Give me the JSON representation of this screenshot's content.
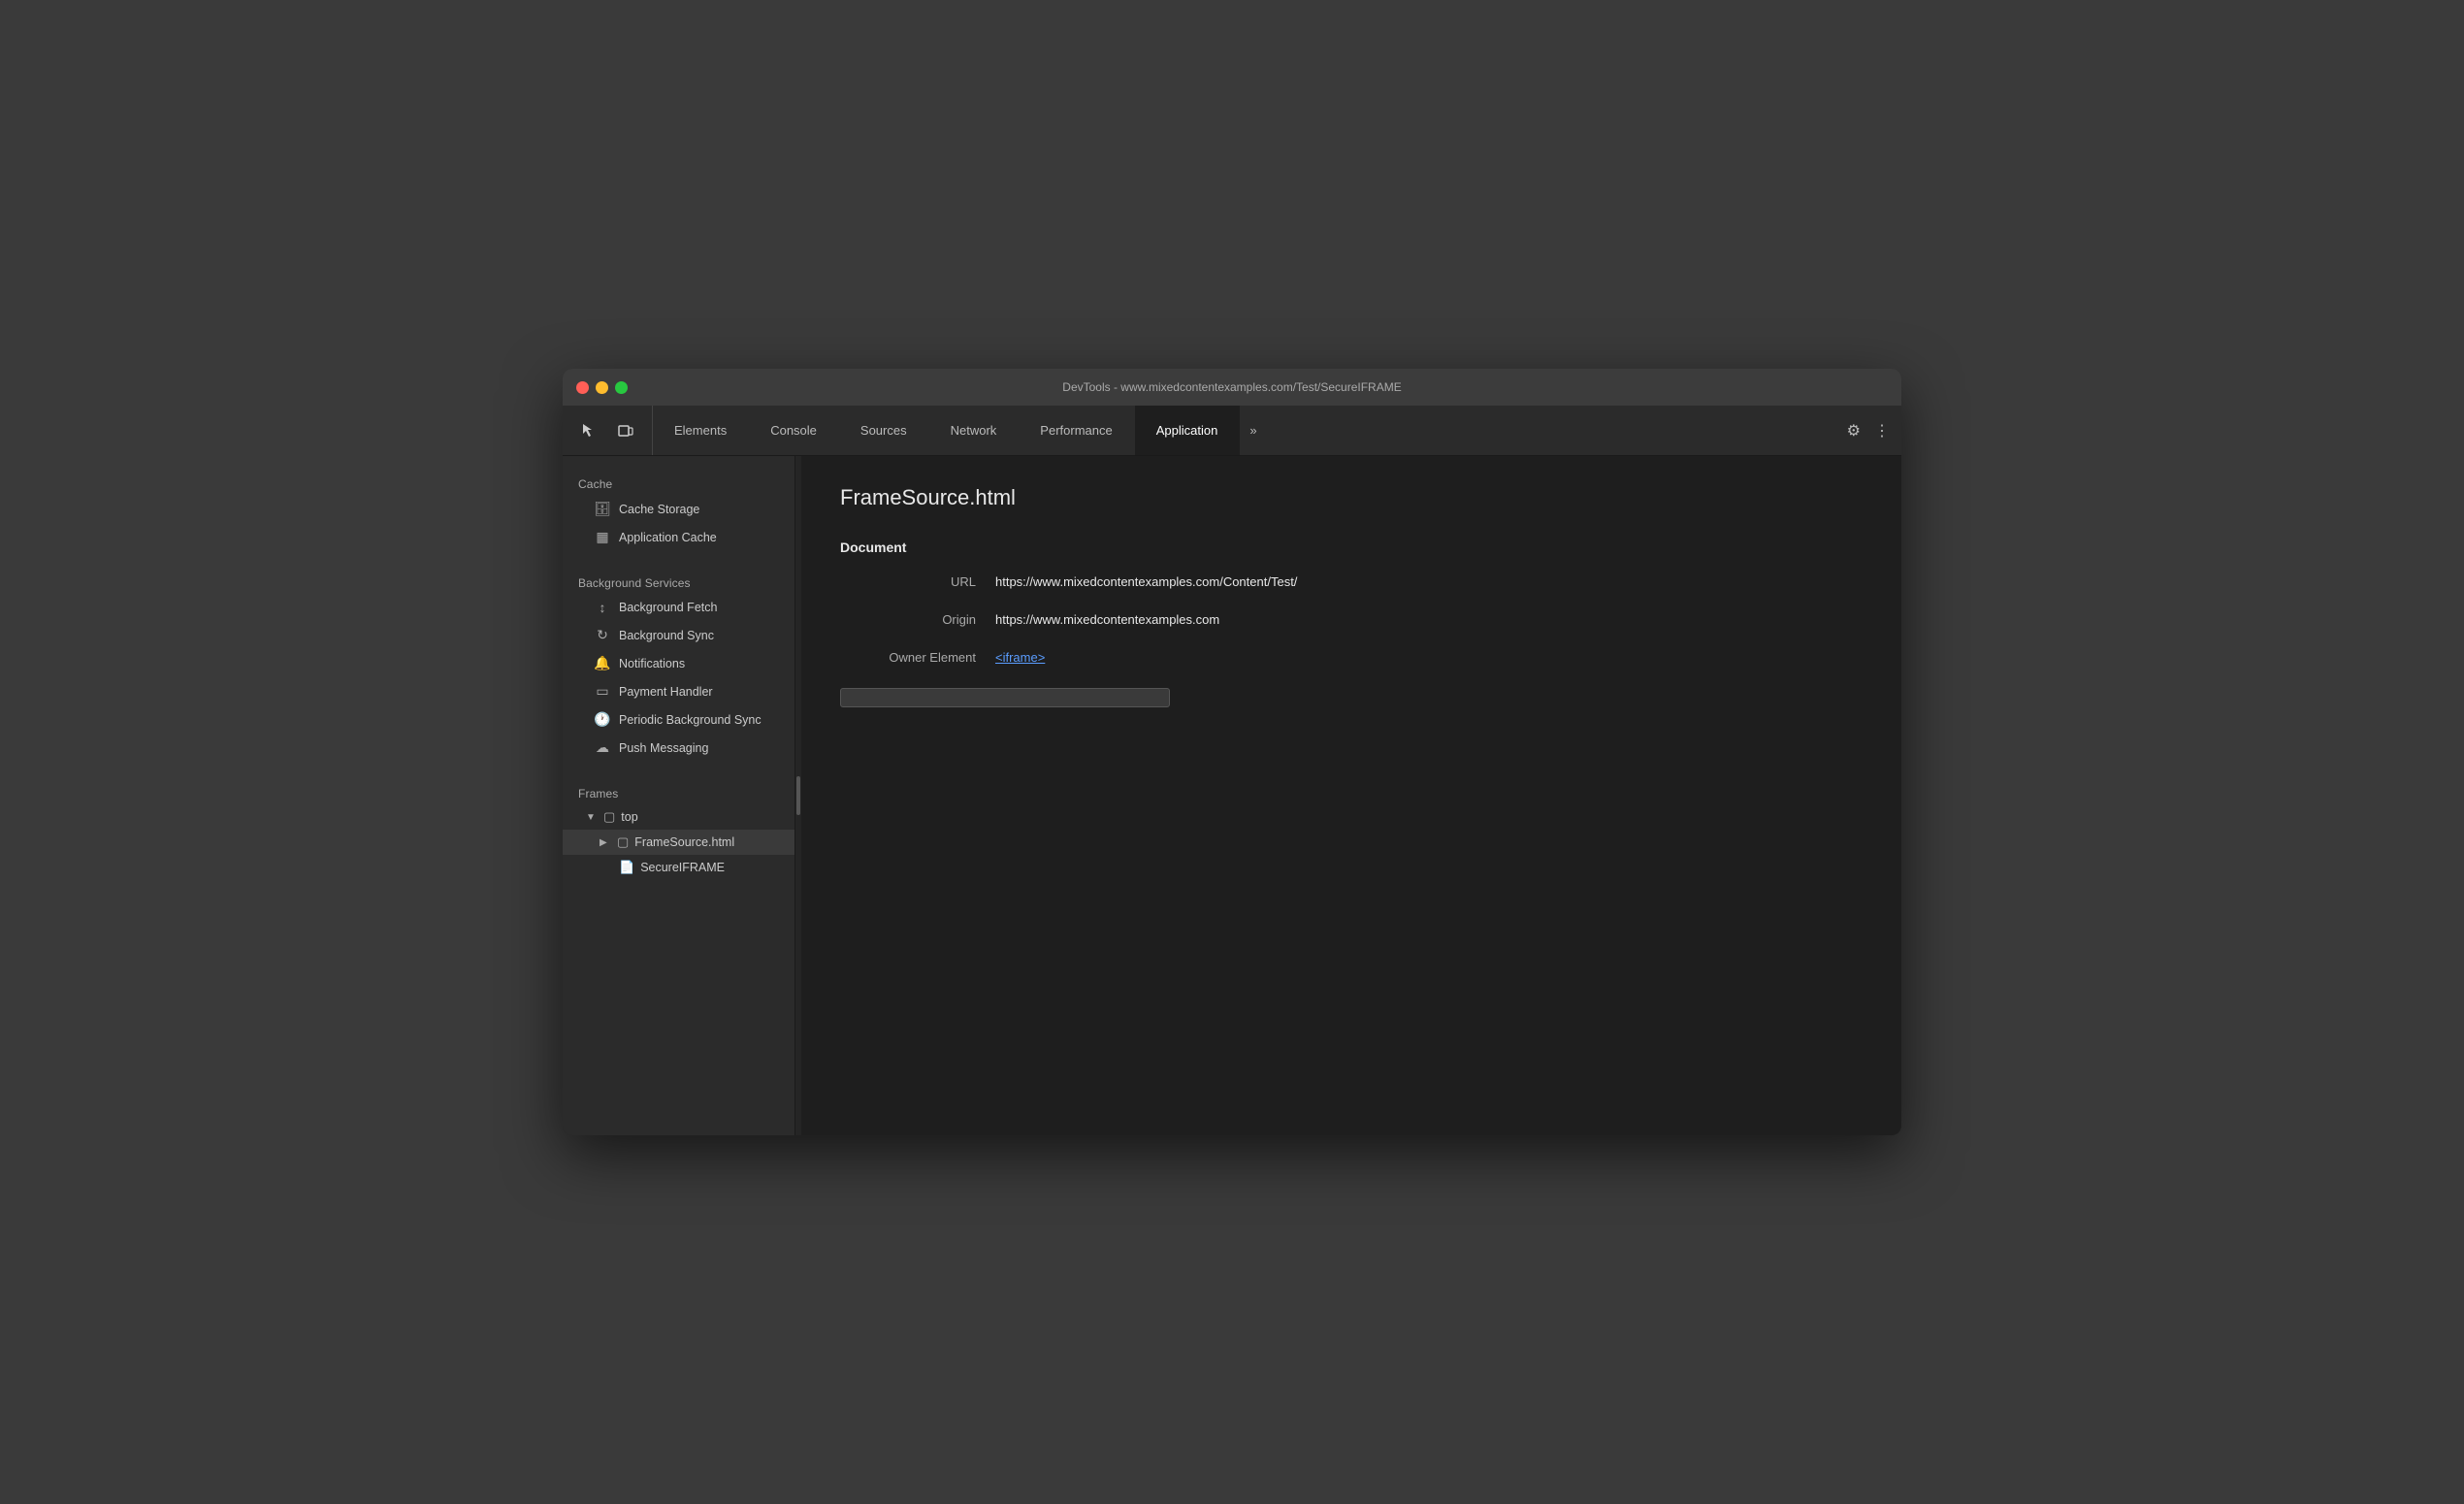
{
  "window": {
    "title": "DevTools - www.mixedcontentexamples.com/Test/SecureIFRAME"
  },
  "tabs": [
    {
      "id": "elements",
      "label": "Elements",
      "active": false
    },
    {
      "id": "console",
      "label": "Console",
      "active": false
    },
    {
      "id": "sources",
      "label": "Sources",
      "active": false
    },
    {
      "id": "network",
      "label": "Network",
      "active": false
    },
    {
      "id": "performance",
      "label": "Performance",
      "active": false
    },
    {
      "id": "application",
      "label": "Application",
      "active": true
    }
  ],
  "sidebar": {
    "sections": {
      "cache_label": "Cache",
      "cache_storage_label": "Cache Storage",
      "app_cache_label": "Application Cache",
      "bg_services_label": "Background Services",
      "bg_fetch_label": "Background Fetch",
      "bg_sync_label": "Background Sync",
      "notifications_label": "Notifications",
      "payment_handler_label": "Payment Handler",
      "periodic_bg_sync_label": "Periodic Background Sync",
      "push_messaging_label": "Push Messaging",
      "frames_label": "Frames",
      "top_label": "top",
      "frame_source_label": "FrameSource.html",
      "secure_iframe_label": "SecureIFRAME"
    }
  },
  "panel": {
    "title": "FrameSource.html",
    "document_header": "Document",
    "url_label": "URL",
    "url_value": "https://www.mixedcontentexamples.com/Content/Test/",
    "origin_label": "Origin",
    "origin_value": "https://www.mixedcontentexamples.com",
    "owner_element_label": "Owner Element",
    "owner_element_value": "<iframe>"
  },
  "toolbar": {
    "overflow_label": "»",
    "settings_icon": "⚙",
    "more_icon": "⋮"
  }
}
